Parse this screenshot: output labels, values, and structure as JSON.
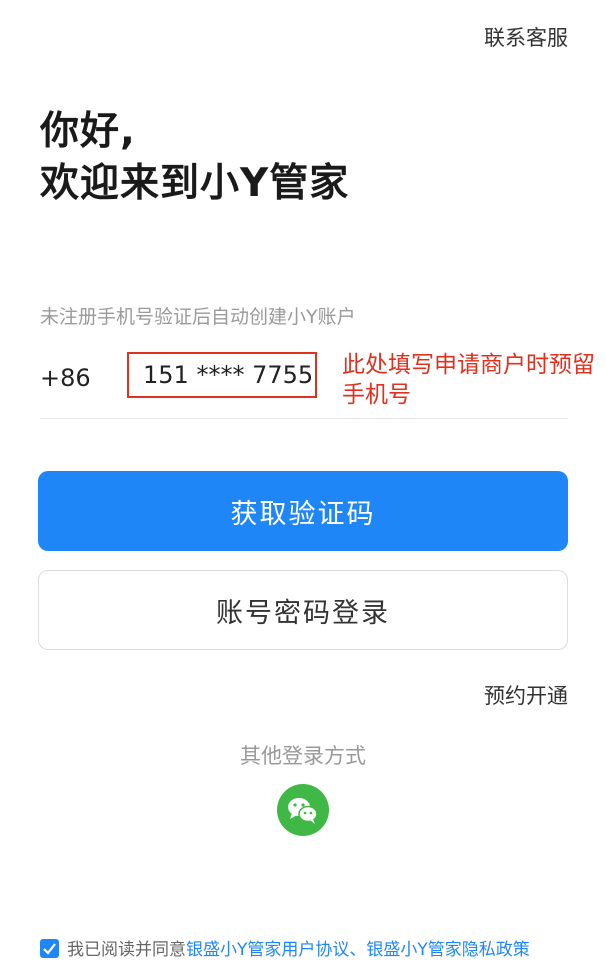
{
  "header": {
    "contact_service": "联系客服"
  },
  "greeting": {
    "line1": "你好,",
    "line2": "欢迎来到小Y管家"
  },
  "login": {
    "hint": "未注册手机号验证后自动创建小Y账户",
    "country_code": "+86",
    "phone_value": "151 **** 7755",
    "annotation": "此处填写申请商户时预留手机号",
    "get_code_label": "获取验证码",
    "password_login_label": "账号密码登录",
    "reserve_label": "预约开通"
  },
  "other_login": {
    "title": "其他登录方式",
    "icon": "wechat-icon"
  },
  "agreement": {
    "prefix": "我已阅读并同意",
    "user_agreement": "银盛小Y管家用户协议",
    "separator": "、",
    "privacy_policy": "银盛小Y管家隐私政策",
    "checked": true
  },
  "colors": {
    "primary": "#1f86f7",
    "annotation": "#e0301e",
    "wechat": "#3fb845"
  }
}
